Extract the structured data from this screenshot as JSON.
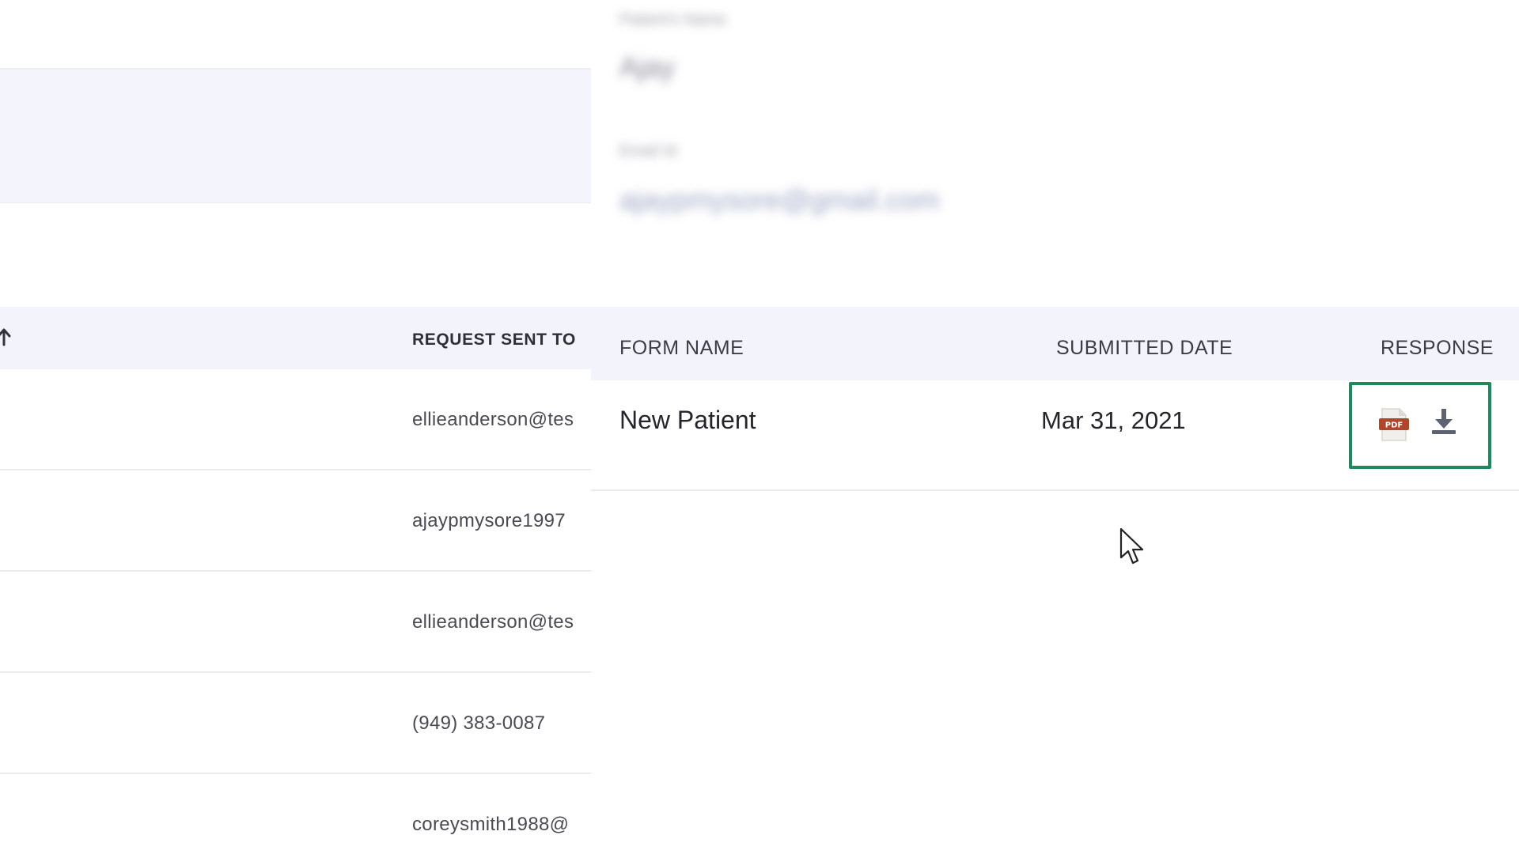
{
  "list": {
    "column_header": "REQUEST SENT TO ",
    "rows": [
      {
        "request_sent_to": "ellieanderson@tes"
      },
      {
        "request_sent_to": "ajaypmysore1997"
      },
      {
        "request_sent_to": "ellieanderson@tes"
      },
      {
        "request_sent_to": "(949) 383-0087"
      },
      {
        "request_sent_to": "coreysmith1988@"
      }
    ]
  },
  "panel": {
    "patient_name_label": "Patient's Name",
    "patient_name_value": "Ajay",
    "email_label": "Email Id",
    "email_value": "ajaypmysore@gmail.com",
    "table": {
      "headers": {
        "form_name": "FORM NAME",
        "submitted_date": "SUBMITTED DATE",
        "response": "RESPONSE"
      },
      "rows": [
        {
          "form_name": "New Patient",
          "submitted_date": "Mar 31, 2021"
        }
      ]
    },
    "icons": {
      "pdf": "pdf-icon",
      "download": "download-icon",
      "pdf_badge_text": "PDF"
    },
    "colors": {
      "highlight_border": "#1e8a5c",
      "header_bg": "#f3f4fb"
    }
  }
}
